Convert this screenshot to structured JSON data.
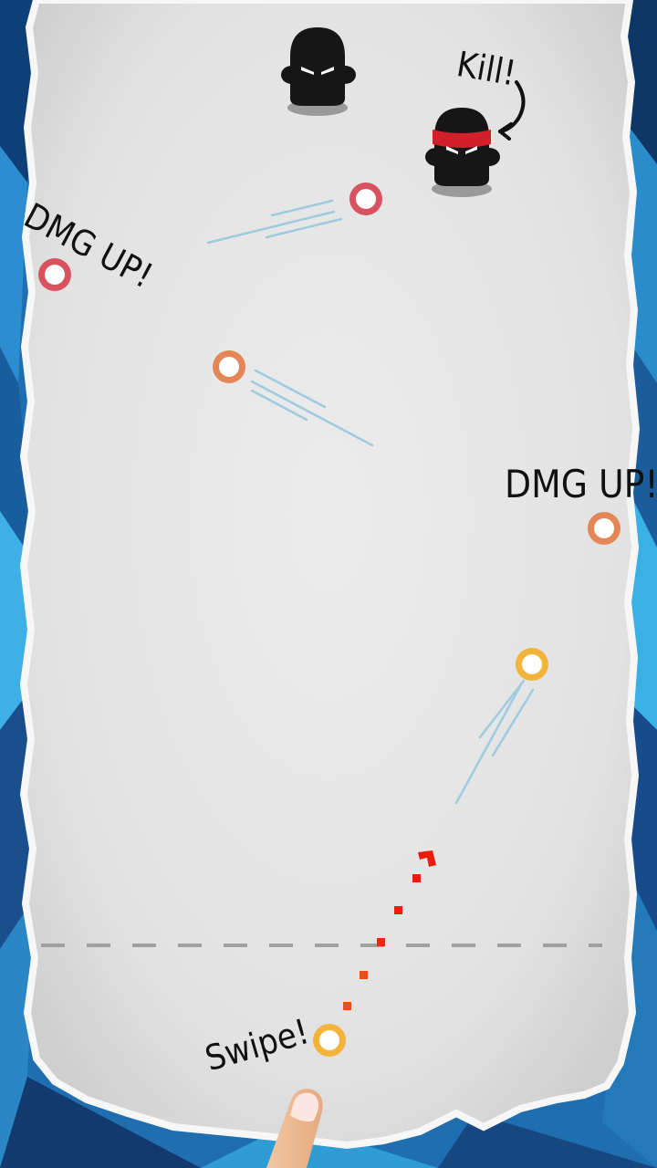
{
  "labels": {
    "kill": "Kill!",
    "dmg_up_left": "DMG UP!",
    "dmg_up_right": "DMG UP!",
    "swipe": "Swipe!"
  },
  "colors": {
    "background_blue": "#1f6fb0",
    "paper": "#e6e6e6",
    "paper_edge": "#c9c9c9",
    "enemy_body": "#161616",
    "headband_red": "#d21f2a",
    "ball_red": "#d9525f",
    "ball_orange": "#e58656",
    "ball_yellow": "#f2b43a",
    "aim_dots_red": "#ee1c0c",
    "aim_dots_orange": "#e8500f",
    "trail_blue": "#9fcbe0",
    "dashed_line": "#9a9a9a"
  },
  "icons": {
    "enemy": "ninja-enemy-icon",
    "enemy_boss": "ninja-red-headband-icon",
    "ball": "ring-ball-icon",
    "finger": "pointing-finger-icon",
    "arrow": "curved-arrow-icon"
  }
}
